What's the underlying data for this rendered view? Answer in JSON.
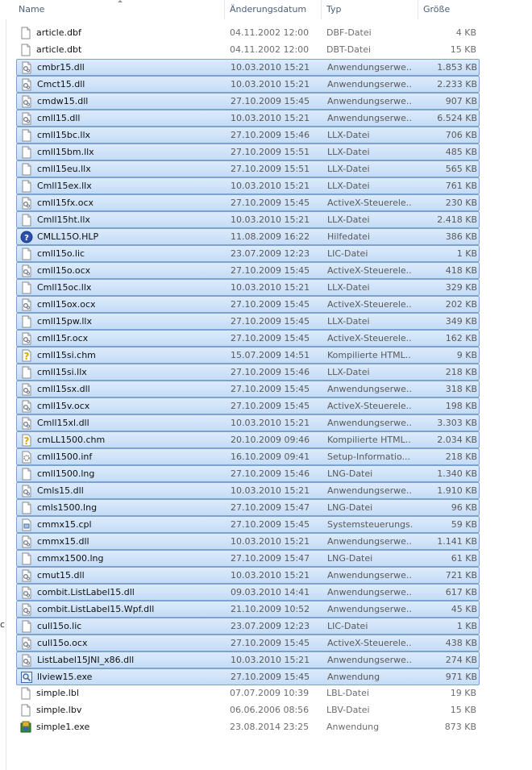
{
  "header": {
    "name": "Name",
    "date": "Änderungsdatum",
    "type": "Typ",
    "size": "Größe"
  },
  "strip": {
    "frag1": "c"
  },
  "files": [
    {
      "name": "article.dbf",
      "date": "04.11.2002 12:00",
      "type": "DBF-Datei",
      "size": "4 KB",
      "icon": "generic-file-icon",
      "selected": false
    },
    {
      "name": "article.dbt",
      "date": "04.11.2002 12:00",
      "type": "DBT-Datei",
      "size": "15 KB",
      "icon": "generic-file-icon",
      "selected": false
    },
    {
      "name": "cmbr15.dll",
      "date": "10.03.2010 15:21",
      "type": "Anwendungserwe...",
      "size": "1.853 KB",
      "icon": "dll-file-icon",
      "selected": true
    },
    {
      "name": "Cmct15.dll",
      "date": "10.03.2010 15:21",
      "type": "Anwendungserwe...",
      "size": "2.233 KB",
      "icon": "dll-file-icon",
      "selected": true
    },
    {
      "name": "cmdw15.dll",
      "date": "27.10.2009 15:45",
      "type": "Anwendungserwe...",
      "size": "907 KB",
      "icon": "dll-file-icon",
      "selected": true
    },
    {
      "name": "cmll15.dll",
      "date": "10.03.2010 15:21",
      "type": "Anwendungserwe...",
      "size": "6.524 KB",
      "icon": "dll-file-icon",
      "selected": true
    },
    {
      "name": "cmll15bc.llx",
      "date": "27.10.2009 15:46",
      "type": "LLX-Datei",
      "size": "706 KB",
      "icon": "generic-file-icon",
      "selected": true
    },
    {
      "name": "cmll15bm.llx",
      "date": "27.10.2009 15:51",
      "type": "LLX-Datei",
      "size": "485 KB",
      "icon": "generic-file-icon",
      "selected": true
    },
    {
      "name": "cmll15eu.llx",
      "date": "27.10.2009 15:51",
      "type": "LLX-Datei",
      "size": "565 KB",
      "icon": "generic-file-icon",
      "selected": true
    },
    {
      "name": "Cmll15ex.llx",
      "date": "10.03.2010 15:21",
      "type": "LLX-Datei",
      "size": "761 KB",
      "icon": "generic-file-icon",
      "selected": true
    },
    {
      "name": "cmll15fx.ocx",
      "date": "27.10.2009 15:45",
      "type": "ActiveX-Steuerele...",
      "size": "230 KB",
      "icon": "dll-file-icon",
      "selected": true
    },
    {
      "name": "Cmll15ht.llx",
      "date": "10.03.2010 15:21",
      "type": "LLX-Datei",
      "size": "2.418 KB",
      "icon": "generic-file-icon",
      "selected": true
    },
    {
      "name": "CMLL15O.HLP",
      "date": "11.08.2009 16:22",
      "type": "Hilfedatei",
      "size": "386 KB",
      "icon": "help-file-icon",
      "selected": true
    },
    {
      "name": "cmll15o.lic",
      "date": "23.07.2009 12:23",
      "type": "LIC-Datei",
      "size": "1 KB",
      "icon": "generic-file-icon",
      "selected": true
    },
    {
      "name": "cmll15o.ocx",
      "date": "27.10.2009 15:45",
      "type": "ActiveX-Steuerele...",
      "size": "418 KB",
      "icon": "dll-file-icon",
      "selected": true
    },
    {
      "name": "Cmll15oc.llx",
      "date": "10.03.2010 15:21",
      "type": "LLX-Datei",
      "size": "329 KB",
      "icon": "generic-file-icon",
      "selected": true
    },
    {
      "name": "cmll15ox.ocx",
      "date": "27.10.2009 15:45",
      "type": "ActiveX-Steuerele...",
      "size": "202 KB",
      "icon": "dll-file-icon",
      "selected": true
    },
    {
      "name": "cmll15pw.llx",
      "date": "27.10.2009 15:45",
      "type": "LLX-Datei",
      "size": "349 KB",
      "icon": "generic-file-icon",
      "selected": true
    },
    {
      "name": "cmll15r.ocx",
      "date": "27.10.2009 15:45",
      "type": "ActiveX-Steuerele...",
      "size": "162 KB",
      "icon": "dll-file-icon",
      "selected": true
    },
    {
      "name": "cmll15si.chm",
      "date": "15.07.2009 14:51",
      "type": "Kompilierte HTML...",
      "size": "9 KB",
      "icon": "chm-help-icon",
      "selected": true
    },
    {
      "name": "cmll15si.llx",
      "date": "27.10.2009 15:46",
      "type": "LLX-Datei",
      "size": "218 KB",
      "icon": "generic-file-icon",
      "selected": true
    },
    {
      "name": "cmll15sx.dll",
      "date": "27.10.2009 15:45",
      "type": "Anwendungserwe...",
      "size": "318 KB",
      "icon": "dll-file-icon",
      "selected": true
    },
    {
      "name": "cmll15v.ocx",
      "date": "27.10.2009 15:45",
      "type": "ActiveX-Steuerele...",
      "size": "198 KB",
      "icon": "dll-file-icon",
      "selected": true
    },
    {
      "name": "Cmll15xl.dll",
      "date": "10.03.2010 15:21",
      "type": "Anwendungserwe...",
      "size": "3.303 KB",
      "icon": "dll-file-icon",
      "selected": true
    },
    {
      "name": "cmLL1500.chm",
      "date": "20.10.2009 09:46",
      "type": "Kompilierte HTML...",
      "size": "2.034 KB",
      "icon": "chm-help-icon",
      "selected": true
    },
    {
      "name": "cmll1500.inf",
      "date": "16.10.2009 09:41",
      "type": "Setup-Informatio...",
      "size": "218 KB",
      "icon": "setup-info-icon",
      "selected": true
    },
    {
      "name": "cmll1500.lng",
      "date": "27.10.2009 15:46",
      "type": "LNG-Datei",
      "size": "1.340 KB",
      "icon": "generic-file-icon",
      "selected": true
    },
    {
      "name": "Cmls15.dll",
      "date": "10.03.2010 15:21",
      "type": "Anwendungserwe...",
      "size": "1.910 KB",
      "icon": "dll-file-icon",
      "selected": true
    },
    {
      "name": "cmls1500.lng",
      "date": "27.10.2009 15:47",
      "type": "LNG-Datei",
      "size": "96 KB",
      "icon": "generic-file-icon",
      "selected": true
    },
    {
      "name": "cmmx15.cpl",
      "date": "27.10.2009 15:45",
      "type": "Systemsteuerungs...",
      "size": "59 KB",
      "icon": "control-panel-icon",
      "selected": true
    },
    {
      "name": "cmmx15.dll",
      "date": "10.03.2010 15:21",
      "type": "Anwendungserwe...",
      "size": "1.141 KB",
      "icon": "dll-file-icon",
      "selected": true
    },
    {
      "name": "cmmx1500.lng",
      "date": "27.10.2009 15:47",
      "type": "LNG-Datei",
      "size": "61 KB",
      "icon": "generic-file-icon",
      "selected": true
    },
    {
      "name": "cmut15.dll",
      "date": "10.03.2010 15:21",
      "type": "Anwendungserwe...",
      "size": "721 KB",
      "icon": "dll-file-icon",
      "selected": true
    },
    {
      "name": "combit.ListLabel15.dll",
      "date": "09.03.2010 14:41",
      "type": "Anwendungserwe...",
      "size": "617 KB",
      "icon": "dll-file-icon",
      "selected": true
    },
    {
      "name": "combit.ListLabel15.Wpf.dll",
      "date": "21.10.2009 10:52",
      "type": "Anwendungserwe...",
      "size": "45 KB",
      "icon": "dll-file-icon",
      "selected": true
    },
    {
      "name": "cull15o.lic",
      "date": "23.07.2009 12:23",
      "type": "LIC-Datei",
      "size": "1 KB",
      "icon": "generic-file-icon",
      "selected": true
    },
    {
      "name": "cull15o.ocx",
      "date": "27.10.2009 15:45",
      "type": "ActiveX-Steuerele...",
      "size": "438 KB",
      "icon": "dll-file-icon",
      "selected": true
    },
    {
      "name": "ListLabel15JNI_x86.dll",
      "date": "10.03.2010 15:21",
      "type": "Anwendungserwe...",
      "size": "274 KB",
      "icon": "dll-file-icon",
      "selected": true
    },
    {
      "name": "llview15.exe",
      "date": "27.10.2009 15:45",
      "type": "Anwendung",
      "size": "971 KB",
      "icon": "viewer-exe-icon",
      "selected": true
    },
    {
      "name": "simple.lbl",
      "date": "07.07.2009 10:39",
      "type": "LBL-Datei",
      "size": "19 KB",
      "icon": "generic-file-icon",
      "selected": false
    },
    {
      "name": "simple.lbv",
      "date": "06.06.2006 08:56",
      "type": "LBV-Datei",
      "size": "15 KB",
      "icon": "generic-file-icon",
      "selected": false
    },
    {
      "name": "simple1.exe",
      "date": "23.08.2014 23:25",
      "type": "Anwendung",
      "size": "873 KB",
      "icon": "app-exe-icon",
      "selected": false
    }
  ]
}
